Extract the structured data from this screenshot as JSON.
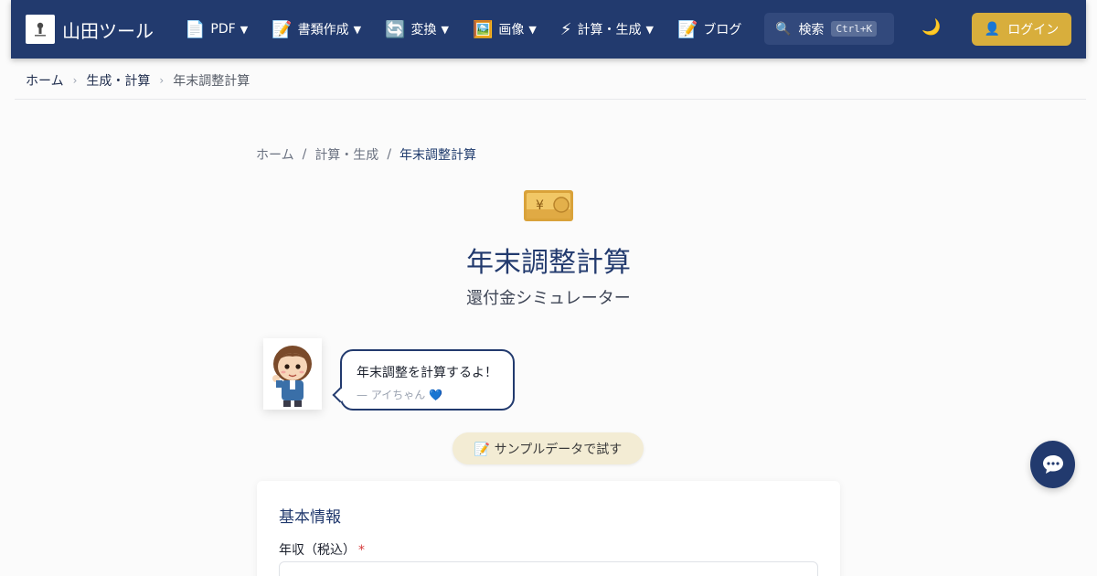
{
  "header": {
    "title": "山田ツール",
    "nav": [
      {
        "icon": "📄",
        "label": "PDF",
        "caret": "▼",
        "icon_name": "document-icon"
      },
      {
        "icon": "📝",
        "label": "書類作成",
        "caret": "▼",
        "icon_name": "memo-icon"
      },
      {
        "icon": "🔄",
        "label": "変換",
        "caret": "▼",
        "icon_name": "convert-icon"
      },
      {
        "icon": "🖼️",
        "label": "画像",
        "caret": "▼",
        "icon_name": "image-icon"
      },
      {
        "icon": "⚡",
        "label": "計算・生成",
        "caret": "▼",
        "icon_name": "lightning-icon"
      },
      {
        "icon": "📝",
        "label": "ブログ",
        "caret": "",
        "icon_name": "memo-icon"
      }
    ],
    "search": {
      "icon": "🔍",
      "label": "検索",
      "shortcut": "Ctrl+K"
    },
    "theme_toggle_icon": "🌙",
    "login": {
      "icon": "👤",
      "label": "ログイン"
    }
  },
  "breadcrumb_top": {
    "items": [
      "ホーム",
      "生成・計算"
    ],
    "separator": "›",
    "current": "年末調整計算"
  },
  "breadcrumb_inner": {
    "items": [
      "ホーム",
      "計算・生成"
    ],
    "separator": "/",
    "current": "年末調整計算"
  },
  "hero": {
    "icon": "money-bill-yen-icon",
    "title": "年末調整計算",
    "subtitle": "還付金シミュレーター"
  },
  "mascot": {
    "message": "年末調整を計算するよ！",
    "signature": "— アイちゃん 💙"
  },
  "sample_button": "📝 サンプルデータで試す",
  "form": {
    "section_title": "基本情報",
    "fields": [
      {
        "label": "年収（税込）",
        "required_mark": "*",
        "value": ""
      }
    ]
  },
  "colors": {
    "header_bg": "#223a6e",
    "accent_gold": "#d8ae3c",
    "required": "#d63b3b",
    "sample_button_bg": "#f3ecd4"
  }
}
